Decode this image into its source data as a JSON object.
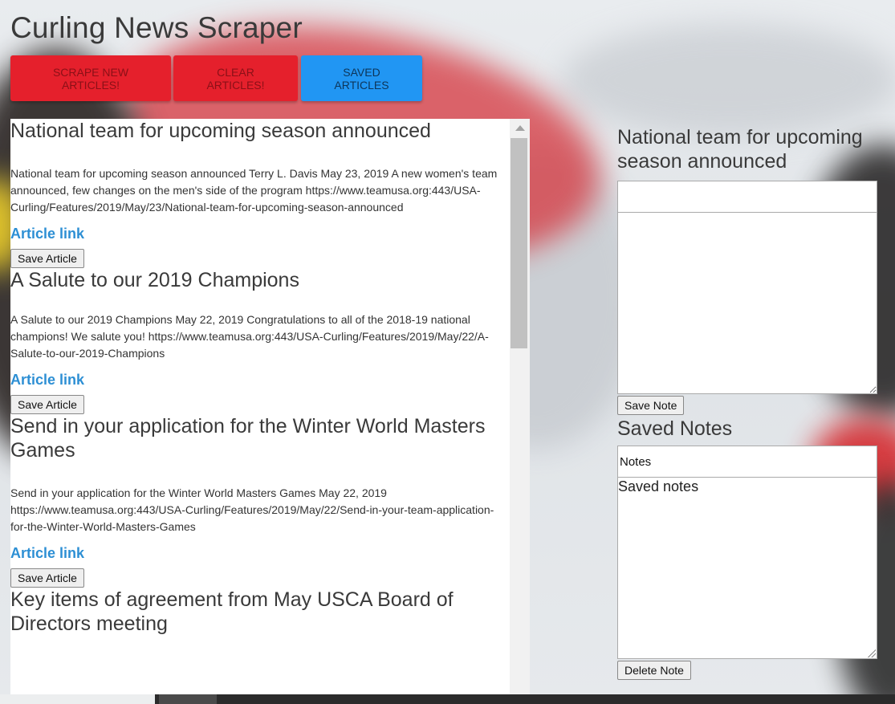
{
  "header": {
    "title": "Curling News Scraper"
  },
  "toolbar": {
    "scrape_label": "SCRAPE NEW ARTICLES!",
    "clear_label": "CLEAR ARTICLES!",
    "saved_label": "SAVED ARTICLES"
  },
  "articles": [
    {
      "title": "National team for upcoming season announced",
      "summary": "National team for upcoming season announced Terry L. Davis May 23, 2019 A new women's team announced, few changes on the men's side of the program https://www.teamusa.org:443/USA-Curling/Features/2019/May/23/National-team-for-upcoming-season-announced",
      "link_label": "Article link",
      "save_label": "Save Article"
    },
    {
      "title": "A Salute to our 2019 Champions",
      "summary": "A Salute to our 2019 Champions May 22, 2019 Congratulations to all of the 2018-19 national champions! We salute you! https://www.teamusa.org:443/USA-Curling/Features/2019/May/22/A-Salute-to-our-2019-Champions",
      "link_label": "Article link",
      "save_label": "Save Article"
    },
    {
      "title": "Send in your application for the Winter World Masters Games",
      "summary": "Send in your application for the Winter World Masters Games May 22, 2019 https://www.teamusa.org:443/USA-Curling/Features/2019/May/22/Send-in-your-team-application-for-the-Winter-World-Masters-Games",
      "link_label": "Article link",
      "save_label": "Save Article"
    },
    {
      "title": "Key items of agreement from May USCA Board of Directors meeting"
    }
  ],
  "notes": {
    "heading": "National team for upcoming season announced",
    "title_value": "",
    "body_value": "",
    "save_label": "Save Note",
    "saved_heading": "Saved Notes",
    "notes_field_value": "Notes",
    "saved_notes_text": "Saved notes",
    "delete_label": "Delete Note"
  },
  "colors": {
    "red_button": "#e5202c",
    "blue_button": "#2196f3",
    "link": "#2d8fd4"
  }
}
